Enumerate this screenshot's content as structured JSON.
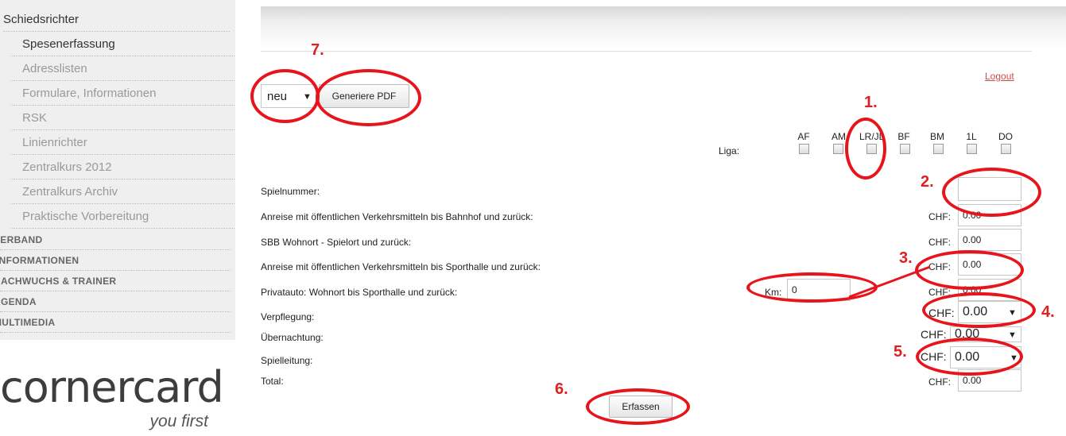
{
  "sidebar": {
    "top_item": "Schiedsrichter",
    "sub_items": [
      {
        "label": "Spesenerfassung",
        "active": true
      },
      {
        "label": "Adresslisten",
        "active": false
      },
      {
        "label": "Formulare, Informationen",
        "active": false
      },
      {
        "label": "RSK",
        "active": false
      },
      {
        "label": "Linienrichter",
        "active": false
      },
      {
        "label": "Zentralkurs 2012",
        "active": false
      },
      {
        "label": "Zentralkurs Archiv",
        "active": false
      },
      {
        "label": "Praktische Vorbereitung",
        "active": false
      }
    ],
    "sections": [
      "VERBAND",
      "INFORMATIONEN",
      "NACHWUCHS & TRAINER",
      "AGENDA",
      "MULTIMEDIA"
    ]
  },
  "logo": {
    "wordmark": "cornercard",
    "tagline": "you first"
  },
  "header": {
    "logout_label": "Logout"
  },
  "toolbar": {
    "select_value": "neu",
    "pdf_button": "Generiere PDF"
  },
  "liga": {
    "label": "Liga:",
    "options": [
      "AF",
      "AM",
      "LR/JL",
      "BF",
      "BM",
      "1L",
      "DO"
    ]
  },
  "form": {
    "currency": "CHF:",
    "km_label": "Km:",
    "km_value": "0",
    "rows": [
      {
        "label": "Spielnummer:",
        "value": ""
      },
      {
        "label": "Anreise mit öffentlichen Verkehrsmitteln bis Bahnhof und zurück:",
        "value": "0.00"
      },
      {
        "label": "SBB Wohnort - Spielort und zurück:",
        "value": "0.00"
      },
      {
        "label": "Anreise mit öffentlichen Verkehrsmitteln bis Sporthalle und zurück:",
        "value": "0.00"
      },
      {
        "label": "Privatauto: Wohnort bis Sporthalle und zurück:",
        "value": "0.00"
      },
      {
        "label": "Verpflegung:",
        "value": "0.00"
      },
      {
        "label": "Übernachtung:",
        "value": "0.00"
      },
      {
        "label": "Spielleitung:",
        "value": "0.00"
      },
      {
        "label": "Total:",
        "value": "0.00"
      }
    ],
    "submit_label": "Erfassen"
  },
  "annotations": [
    "1.",
    "2.",
    "3.",
    "4.",
    "5.",
    "6.",
    "7."
  ],
  "colors": {
    "annotation": "#e8141c",
    "logout": "#c94c4c",
    "sidebar_bg": "#efefef"
  }
}
